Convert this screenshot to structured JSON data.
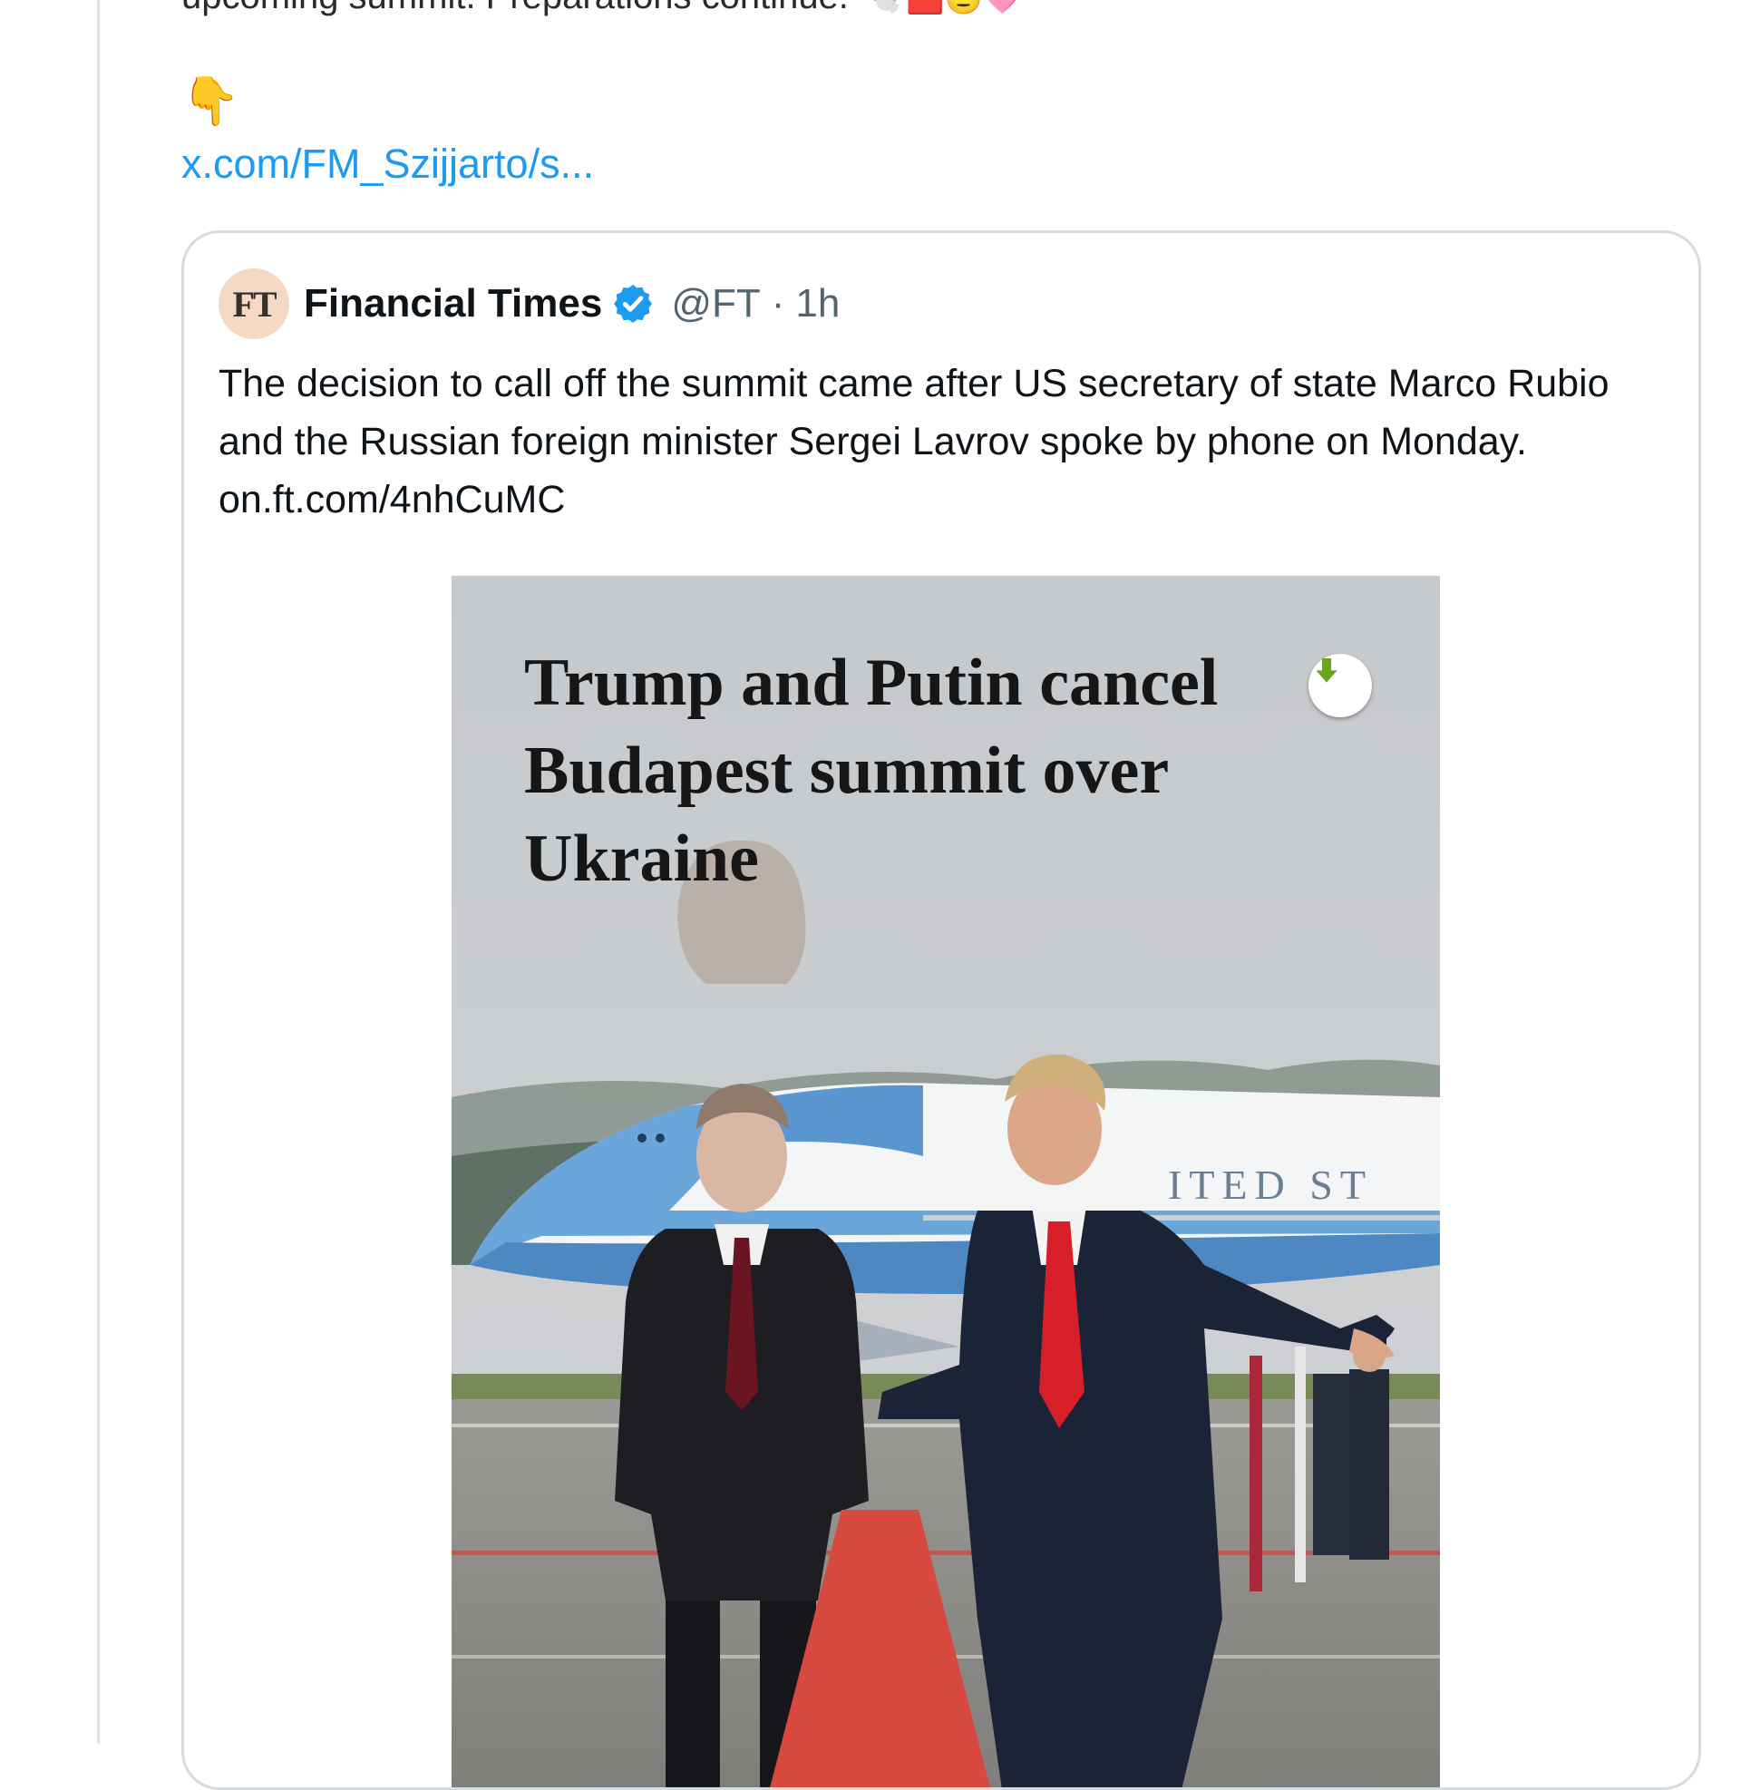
{
  "post": {
    "cut_text": "upcoming summit. Preparations continue.",
    "cut_emojis": "🕊️🟥🫡🩷",
    "pointing_emoji": "👇",
    "link_text": "x.com/FM_Szijjarto/s..."
  },
  "quote": {
    "avatar_text": "FT",
    "author_name": "Financial Times",
    "handle": "@FT",
    "separator": "·",
    "time": "1h",
    "text": "The decision to call off the summit came after US secretary of state Marco Rubio and the Russian foreign minister Sergei Lavrov spoke by phone on Monday.",
    "link": "on.ft.com/4nhCuMC",
    "media": {
      "headline": "Trump and Putin cancel Budapest summit over Ukraine",
      "plane_lettering": "ITED ST"
    }
  },
  "icons": {
    "verified": "verified-badge-icon",
    "save": "download-arrow-icon"
  },
  "colors": {
    "link": "#1d9bf0",
    "verified": "#1d9bf0",
    "text": "#0f1419",
    "muted": "#536471",
    "save_arrow": "#6aa521"
  }
}
